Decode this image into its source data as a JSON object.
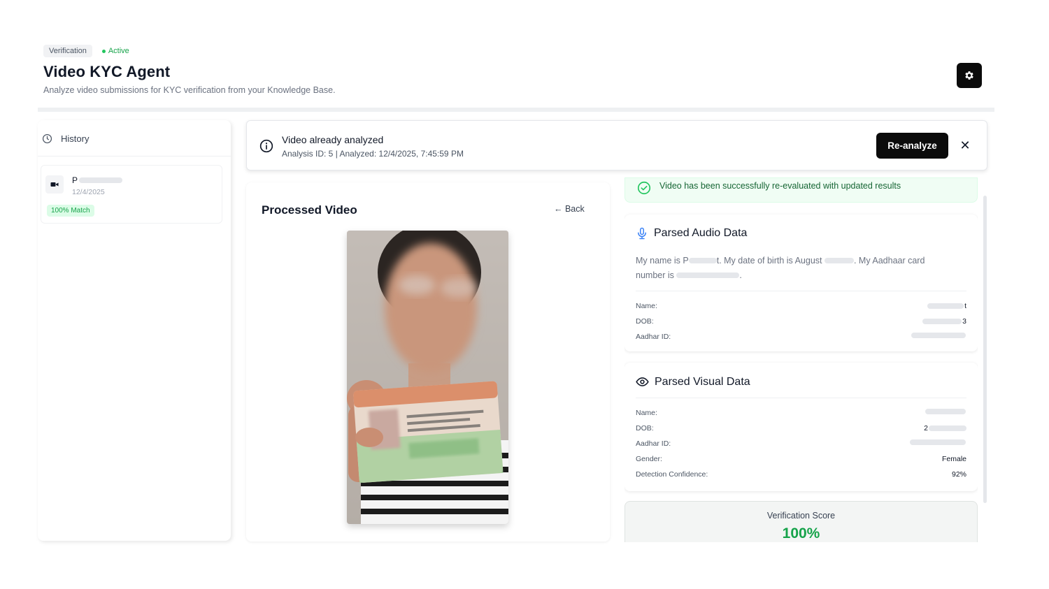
{
  "header": {
    "breadcrumb": "Verification",
    "status": "Active",
    "title": "Video KYC Agent",
    "subtitle": "Analyze video submissions for KYC verification from your Knowledge Base."
  },
  "history": {
    "title": "History",
    "items": [
      {
        "name": "P",
        "date": "12/4/2025",
        "badge": "100% Match"
      }
    ]
  },
  "notice": {
    "title": "Video already analyzed",
    "meta": "Analysis ID: 5 | Analyzed: 12/4/2025, 7:45:59 PM",
    "reanalyze_label": "Re-analyze",
    "close_label": "✕"
  },
  "video": {
    "title": "Processed Video",
    "back_label": "← Back"
  },
  "success": {
    "text": "Video has been successfully re-evaluated with updated results"
  },
  "audio": {
    "title": "Parsed Audio Data",
    "transcript_1": "My name is P",
    "transcript_2": "t. My date of birth is August",
    "transcript_3": ". My Aadhaar card",
    "transcript_4": "number is",
    "transcript_5": ".",
    "fields": [
      {
        "label": "Name:",
        "value": "t"
      },
      {
        "label": "DOB:",
        "value": "3"
      },
      {
        "label": "Aadhar ID:",
        "value": ""
      }
    ]
  },
  "visual": {
    "title": "Parsed Visual Data",
    "fields": [
      {
        "label": "Name:",
        "value": ""
      },
      {
        "label": "DOB:",
        "value": "2"
      },
      {
        "label": "Aadhar ID:",
        "value": ""
      },
      {
        "label": "Gender:",
        "value": "Female"
      },
      {
        "label": "Detection Confidence:",
        "value": "92%"
      }
    ]
  },
  "score": {
    "label": "Verification Score",
    "value": "100%"
  },
  "colors": {
    "accent_green": "#16a34a",
    "button_dark": "#0b0b0b"
  }
}
